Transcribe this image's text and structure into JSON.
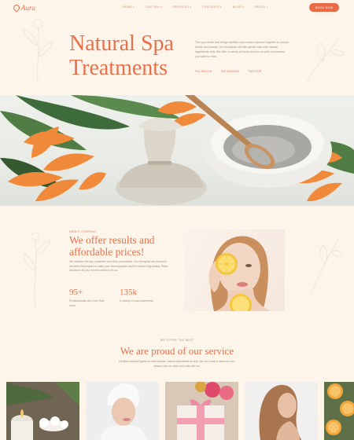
{
  "brand": {
    "name": "Aura"
  },
  "nav": {
    "items": [
      {
        "label": "HOME"
      },
      {
        "label": "OUR SPA"
      },
      {
        "label": "SERVICES"
      },
      {
        "label": "FEATURES"
      },
      {
        "label": "BLOG"
      },
      {
        "label": "PAGES"
      }
    ],
    "cta_label": "BOOK NOW"
  },
  "hero": {
    "title": "Natural Spa Treatments",
    "text": "The spa center that brings tradition and modern science together to restore health and beauty. Our therapists will take gentle care with natural ingredients only. We offer a variety of facial services so pick a treatment you want to relax.",
    "social": [
      "FACEBOOK",
      "INSTAGRAM",
      "TWITTER"
    ]
  },
  "about": {
    "eyebrow": "ABOUT COMPANY",
    "title": "We offer results and affordable prices!",
    "text": "We combine therapy, treatment and other procedures. Our therapists are trained in the latest techniques to make your visit enjoyable and the results long lasting. Relax and leave all your worries behind with us.",
    "stats": [
      {
        "value": "95+",
        "label": "Professionals who love their work"
      },
      {
        "value": "135k",
        "label": "A variety of spa treatments"
      }
    ]
  },
  "service": {
    "eyebrow": "WE OFFER THE BEST",
    "title": "We are proud of our service",
    "text": "Facilisis that best game for with rational, natural ingredients as only. We can't wait to welcome you, please visit our salon and relax with us."
  },
  "colors": {
    "accent": "#e8704b",
    "background": "#fdf5ea",
    "button": "#ea6a43"
  }
}
